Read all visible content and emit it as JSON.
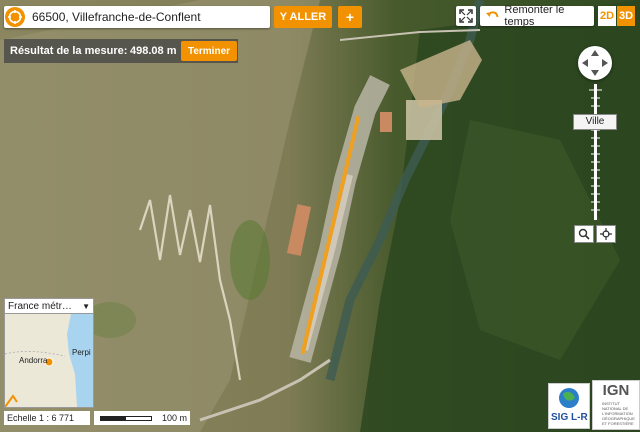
{
  "search": {
    "value": "66500, Villefranche-de-Conflent",
    "go_label": "Y ALLER",
    "add_label": "+"
  },
  "measure": {
    "label": "Résultat de la mesure:",
    "value": "498.08 m",
    "finish_label": "Terminer"
  },
  "tools": {
    "history_label": "Remonter le temps",
    "mode_2d": "2D",
    "mode_3d": "3D"
  },
  "zoom": {
    "level_label": "Ville"
  },
  "overview": {
    "selected": "France métr…",
    "labels": {
      "andorra": "Andorra",
      "perpignan": "Perpi"
    }
  },
  "scale": {
    "ratio": "Echelle 1 : 6 771",
    "distance": "100 m"
  },
  "logos": {
    "sig_text": "SIG L-R",
    "ign_text": "IGN",
    "ign_subtitle": "INSTITUT NATIONAL DE L'INFORMATION GÉOGRAPHIQUE ET FORESTIÈRE"
  },
  "colors": {
    "accent": "#f39200",
    "measure_line": "#f0a020"
  }
}
